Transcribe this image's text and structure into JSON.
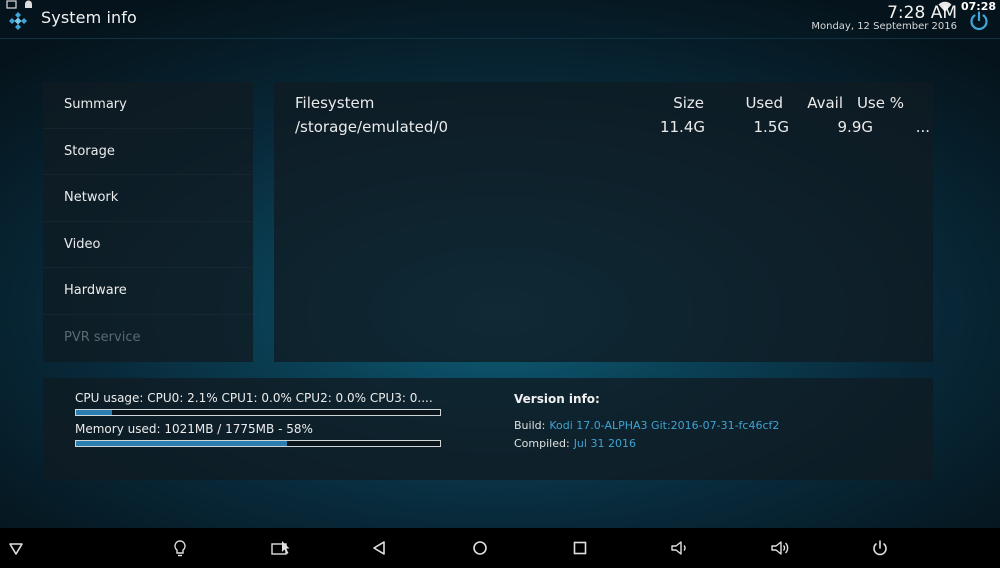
{
  "header": {
    "title": "System info",
    "clock": "7:28 AM",
    "date": "Monday, 12 September 2016",
    "system_clock": "07:28"
  },
  "sidebar": {
    "items": [
      {
        "label": "Summary",
        "enabled": true
      },
      {
        "label": "Storage",
        "enabled": true
      },
      {
        "label": "Network",
        "enabled": true
      },
      {
        "label": "Video",
        "enabled": true
      },
      {
        "label": "Hardware",
        "enabled": true
      },
      {
        "label": "PVR service",
        "enabled": false
      }
    ]
  },
  "storage": {
    "columns": [
      "Filesystem",
      "Size",
      "Used",
      "Avail",
      "Use %"
    ],
    "rows": [
      [
        "/storage/emulated/0",
        "11.4G",
        "1.5G",
        "9.9G",
        "..."
      ]
    ]
  },
  "usage": {
    "cpu_label": "CPU usage: CPU0: 2.1% CPU1: 0.0% CPU2: 0.0% CPU3: 0....",
    "cpu_percent": 10,
    "memory_label": "Memory used: 1021MB / 1775MB - 58%",
    "memory_percent": 58
  },
  "version": {
    "title": "Version info:",
    "build_label": "Build:",
    "build_value": "Kodi 17.0-ALPHA3 Git:2016-07-31-fc46cf2",
    "compiled_label": "Compiled:",
    "compiled_value": "Jul 31 2016"
  },
  "colors": {
    "accent": "#3fa3d2",
    "bar_fill": "#2b7fae",
    "disabled_text": "#5b6a72"
  },
  "navbar": {
    "icons": [
      "hide-nav-icon",
      "lightbulb-icon",
      "screenshot-icon",
      "back-icon",
      "home-icon",
      "recents-icon",
      "volume-down-icon",
      "volume-up-icon",
      "power-icon"
    ]
  }
}
